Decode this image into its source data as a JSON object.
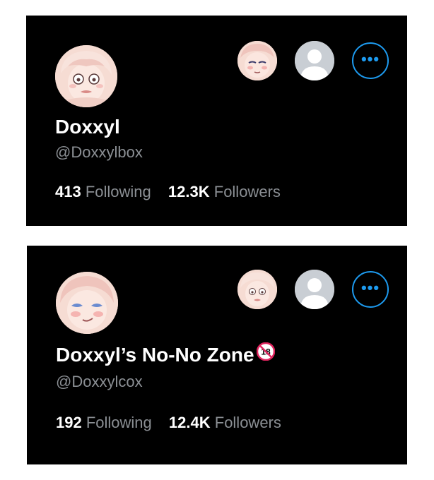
{
  "profiles": [
    {
      "display_name": "Doxxyl",
      "handle": "@Doxxylbox",
      "following_count": "413",
      "following_label": "Following",
      "followers_count": "12.3K",
      "followers_label": "Followers",
      "more_icon": "•••"
    },
    {
      "display_name": "Doxxyl’s No-No Zone",
      "handle": "@Doxxylcox",
      "following_count": "192",
      "following_label": "Following",
      "followers_count": "12.4K",
      "followers_label": "Followers",
      "more_icon": "•••",
      "badge": "18"
    }
  ],
  "colors": {
    "background": "#000000",
    "accent": "#1d9bf0",
    "secondary_text": "#8b8f94",
    "default_avatar": "#c9ced4"
  }
}
